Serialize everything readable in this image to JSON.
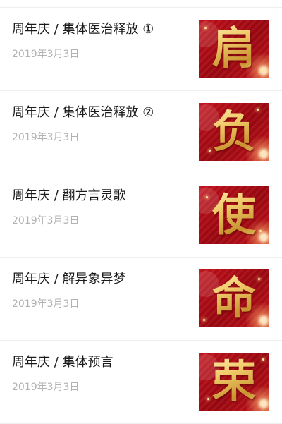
{
  "articles": [
    {
      "title": "周年庆 / 集体医治释放 ①",
      "date": "2019年3月3日",
      "thumb_char": "肩"
    },
    {
      "title": "周年庆 / 集体医治释放 ②",
      "date": "2019年3月3日",
      "thumb_char": "负"
    },
    {
      "title": "周年庆 / 翻方言灵歌",
      "date": "2019年3月3日",
      "thumb_char": "使"
    },
    {
      "title": "周年庆 / 解异象异梦",
      "date": "2019年3月3日",
      "thumb_char": "命"
    },
    {
      "title": "周年庆 / 集体预言",
      "date": "2019年3月3日",
      "thumb_char": "荣"
    }
  ],
  "colors": {
    "title_text": "#1a1a1a",
    "date_text": "#b2b2b2",
    "thumb_red": "#c4121b",
    "thumb_gold": "#f2cd6e",
    "divider": "#eeeeee"
  }
}
